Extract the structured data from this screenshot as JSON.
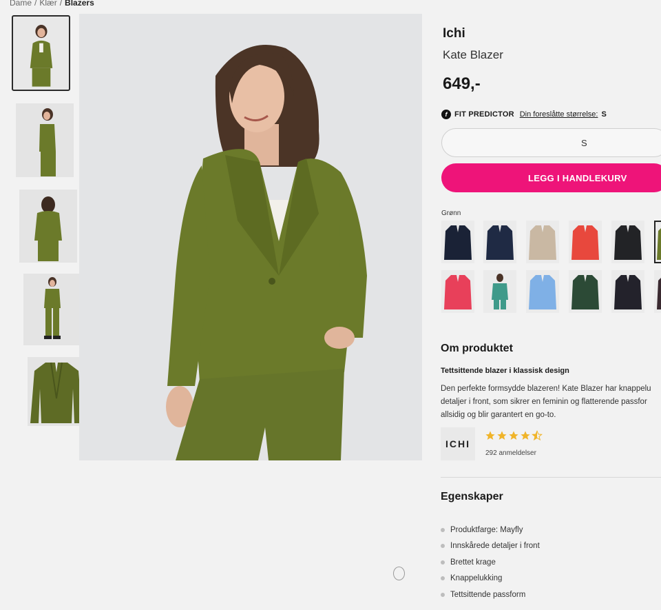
{
  "breadcrumb": {
    "items": [
      "Dame",
      "Klær"
    ],
    "current": "Blazers",
    "separator": "/"
  },
  "product": {
    "brand": "Ichi",
    "name": "Kate Blazer",
    "price": "649,-",
    "main_image": "model-in-olive-blazer",
    "jacket_color": "#6b7a2a"
  },
  "thumbnails": [
    {
      "icon": "model-front-thumbnail",
      "active": true
    },
    {
      "icon": "model-side-thumbnail",
      "active": false
    },
    {
      "icon": "model-back-thumbnail",
      "active": false
    },
    {
      "icon": "model-full-thumbnail",
      "active": false
    },
    {
      "icon": "blazer-flat-thumbnail",
      "active": false
    }
  ],
  "fit_predictor": {
    "label": "FIT PREDICTOR",
    "link_text": "Din foreslåtte størrelse:",
    "size": "S",
    "icon": "fit-predictor-icon"
  },
  "size_select": {
    "value": "S"
  },
  "cart_button": {
    "label": "LEGG I HANDLEKURV",
    "color": "#ee1479"
  },
  "colors": {
    "label": "Grønn",
    "swatches_row1": [
      {
        "color": "#1a2236",
        "name": "navy"
      },
      {
        "color": "#1f2a44",
        "name": "dark-navy"
      },
      {
        "color": "#c9b8a3",
        "name": "beige"
      },
      {
        "color": "#e8483d",
        "name": "red"
      },
      {
        "color": "#222326",
        "name": "black"
      },
      {
        "color": "#6b7a2a",
        "name": "olive"
      }
    ],
    "swatches_row2": [
      {
        "color": "#e8405a",
        "name": "pink"
      },
      {
        "color": "#3f9a8a",
        "name": "teal"
      },
      {
        "color": "#7fb0e6",
        "name": "light-blue"
      },
      {
        "color": "#2c4a36",
        "name": "dark-green"
      },
      {
        "color": "#23222b",
        "name": "charcoal"
      },
      {
        "color": "#3a2a30",
        "name": "dark-brown"
      }
    ]
  },
  "about": {
    "title": "Om produktet",
    "subtitle": "Tettsittende blazer i klassisk design",
    "description_lines": [
      "Den perfekte formsydde blazeren! Kate Blazer har knappelu",
      "detaljer i front, som sikrer en feminin og flatterende passfor",
      "allsidig og blir garantert en go-to."
    ],
    "brand_logo_text": "ICHI",
    "rating": 4.5,
    "rating_max": 5,
    "reviews": "292 anmeldelser"
  },
  "features": {
    "title": "Egenskaper",
    "items": [
      "Produktfarge: Mayfly",
      "Innskårede detaljer i front",
      "Brettet krage",
      "Knappelukking",
      "Tettsittende passform"
    ]
  }
}
